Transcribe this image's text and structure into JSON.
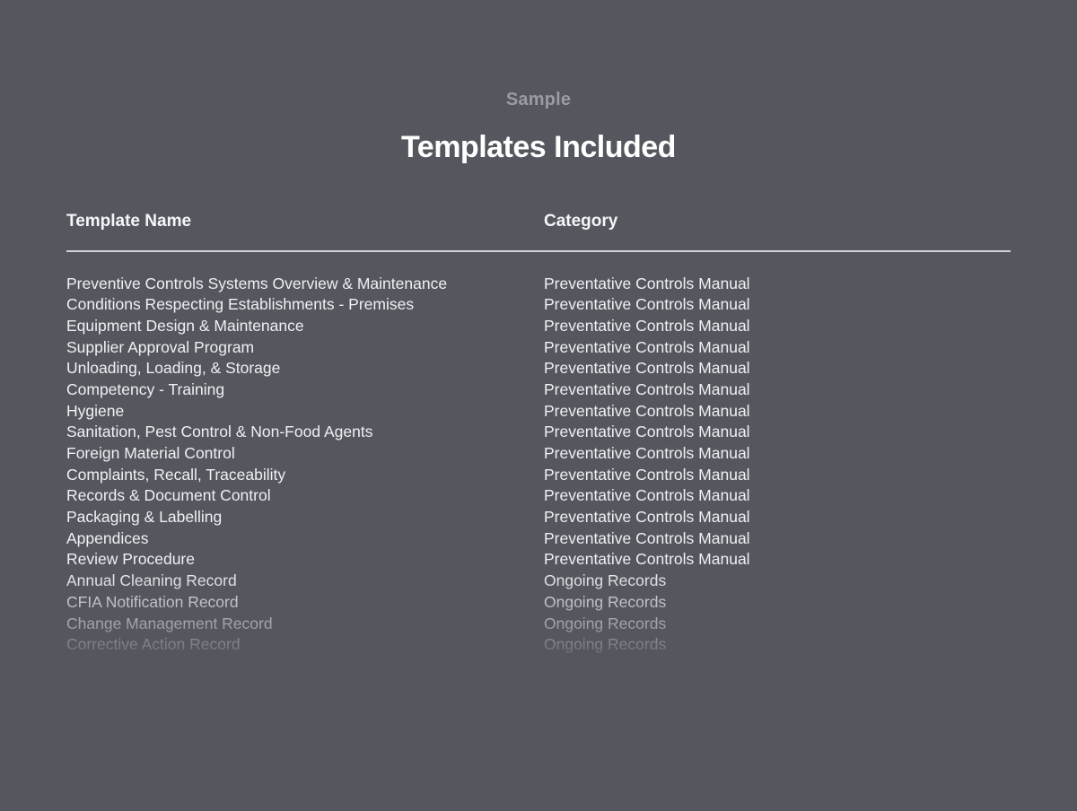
{
  "header": {
    "eyebrow": "Sample",
    "title": "Templates Included"
  },
  "table": {
    "columns": {
      "name": "Template Name",
      "category": "Category"
    },
    "rows": [
      {
        "name": "Preventive Controls Systems Overview & Maintenance",
        "category": "Preventative Controls Manual"
      },
      {
        "name": "Conditions Respecting Establishments - Premises",
        "category": "Preventative Controls Manual"
      },
      {
        "name": "Equipment Design & Maintenance",
        "category": "Preventative Controls Manual"
      },
      {
        "name": "Supplier Approval Program",
        "category": "Preventative Controls Manual"
      },
      {
        "name": "Unloading, Loading, & Storage",
        "category": "Preventative Controls Manual"
      },
      {
        "name": "Competency - Training",
        "category": "Preventative Controls Manual"
      },
      {
        "name": "Hygiene",
        "category": "Preventative Controls Manual"
      },
      {
        "name": "Sanitation, Pest Control & Non-Food Agents",
        "category": "Preventative Controls Manual"
      },
      {
        "name": "Foreign Material Control",
        "category": "Preventative Controls Manual"
      },
      {
        "name": "Complaints, Recall, Traceability",
        "category": "Preventative Controls Manual"
      },
      {
        "name": "Records & Document Control",
        "category": "Preventative Controls Manual"
      },
      {
        "name": "Packaging & Labelling",
        "category": "Preventative Controls Manual"
      },
      {
        "name": "Appendices",
        "category": "Preventative Controls Manual"
      },
      {
        "name": "Review Procedure",
        "category": "Preventative Controls Manual"
      },
      {
        "name": "Annual Cleaning Record",
        "category": "Ongoing Records"
      },
      {
        "name": "CFIA Notification Record",
        "category": "Ongoing Records"
      },
      {
        "name": "Change Management Record",
        "category": "Ongoing Records"
      },
      {
        "name": "Corrective Action Record",
        "category": "Ongoing Records"
      }
    ]
  }
}
